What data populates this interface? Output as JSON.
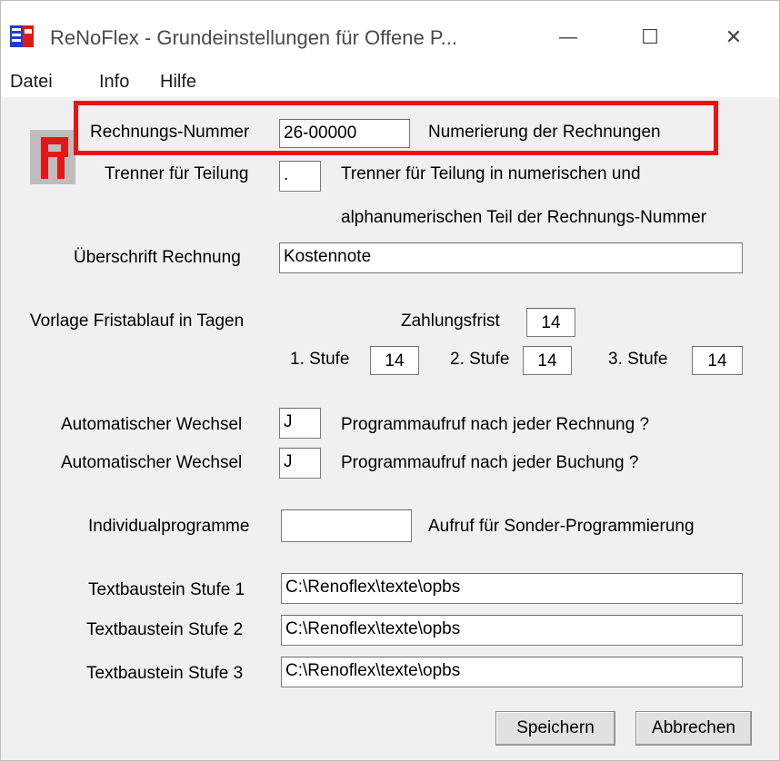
{
  "window": {
    "title": "ReNoFlex  -  Grundeinstellungen für Offene P...",
    "minimize_symbol": "—",
    "maximize_symbol": "☐",
    "close_symbol": "✕"
  },
  "menu": [
    "Datei",
    "Info",
    "Hilfe"
  ],
  "form": {
    "rechnungsnummer": {
      "label": "Rechnungs-Nummer",
      "value": "26-00000",
      "hint": "Numerierung der Rechnungen"
    },
    "trenner": {
      "label": "Trenner für Teilung",
      "value": ".",
      "hint1": "Trenner für Teilung in numerischen und",
      "hint2": "alphanumerischen Teil der Rechnungs-Nummer"
    },
    "ueberschrift": {
      "label": "Überschrift Rechnung",
      "value": "Kostennote"
    },
    "frist": {
      "label": "Vorlage Fristablauf in Tagen",
      "zahlungsfrist_label": "Zahlungsfrist",
      "zahlungsfrist_value": "14",
      "stufe1_label": "1. Stufe",
      "stufe1_value": "14",
      "stufe2_label": "2. Stufe",
      "stufe2_value": "14",
      "stufe3_label": "3. Stufe",
      "stufe3_value": "14"
    },
    "wechsel1": {
      "label": "Automatischer Wechsel",
      "value": "J",
      "hint": "Programmaufruf nach jeder Rechnung ?"
    },
    "wechsel2": {
      "label": "Automatischer Wechsel",
      "value": "J",
      "hint": "Programmaufruf nach jeder Buchung ?"
    },
    "individual": {
      "label": "Individualprogramme",
      "value": "",
      "hint": "Aufruf für Sonder-Programmierung"
    },
    "textbaustein1": {
      "label": "Textbaustein Stufe 1",
      "value": "C:\\Renoflex\\texte\\opbs"
    },
    "textbaustein2": {
      "label": "Textbaustein Stufe 2",
      "value": "C:\\Renoflex\\texte\\opbs"
    },
    "textbaustein3": {
      "label": "Textbaustein Stufe 3",
      "value": "C:\\Renoflex\\texte\\opbs"
    }
  },
  "buttons": {
    "save": "Speichern",
    "cancel": "Abbrechen"
  },
  "colors": {
    "highlight": "#ee1111",
    "logo_red": "#e01818",
    "logo_bg": "#bdbdbd"
  }
}
